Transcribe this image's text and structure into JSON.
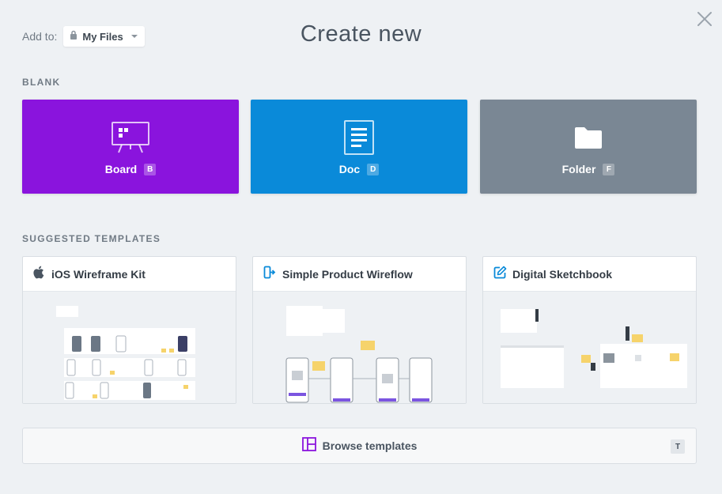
{
  "header": {
    "add_to_label": "Add to:",
    "location_value": "My Files",
    "title": "Create new"
  },
  "blank": {
    "section_label": "BLANK",
    "cards": [
      {
        "label": "Board",
        "shortcut": "B",
        "color": "#8a14dd",
        "icon": "board-icon"
      },
      {
        "label": "Doc",
        "shortcut": "D",
        "color": "#0a8ad9",
        "icon": "doc-icon"
      },
      {
        "label": "Folder",
        "shortcut": "F",
        "color": "#7a8794",
        "icon": "folder-icon"
      }
    ]
  },
  "templates": {
    "section_label": "SUGGESTED TEMPLATES",
    "cards": [
      {
        "title": "iOS Wireframe Kit",
        "icon": "apple-icon"
      },
      {
        "title": "Simple Product Wireflow",
        "icon": "wireflow-icon"
      },
      {
        "title": "Digital Sketchbook",
        "icon": "edit-icon"
      }
    ]
  },
  "browse": {
    "label": "Browse templates",
    "shortcut": "T",
    "icon": "template-layout-icon"
  },
  "colors": {
    "board": "#8a14dd",
    "doc": "#0a8ad9",
    "folder": "#7a8794",
    "accent_blue": "#0a8ad9",
    "accent_purple": "#8a14dd"
  }
}
